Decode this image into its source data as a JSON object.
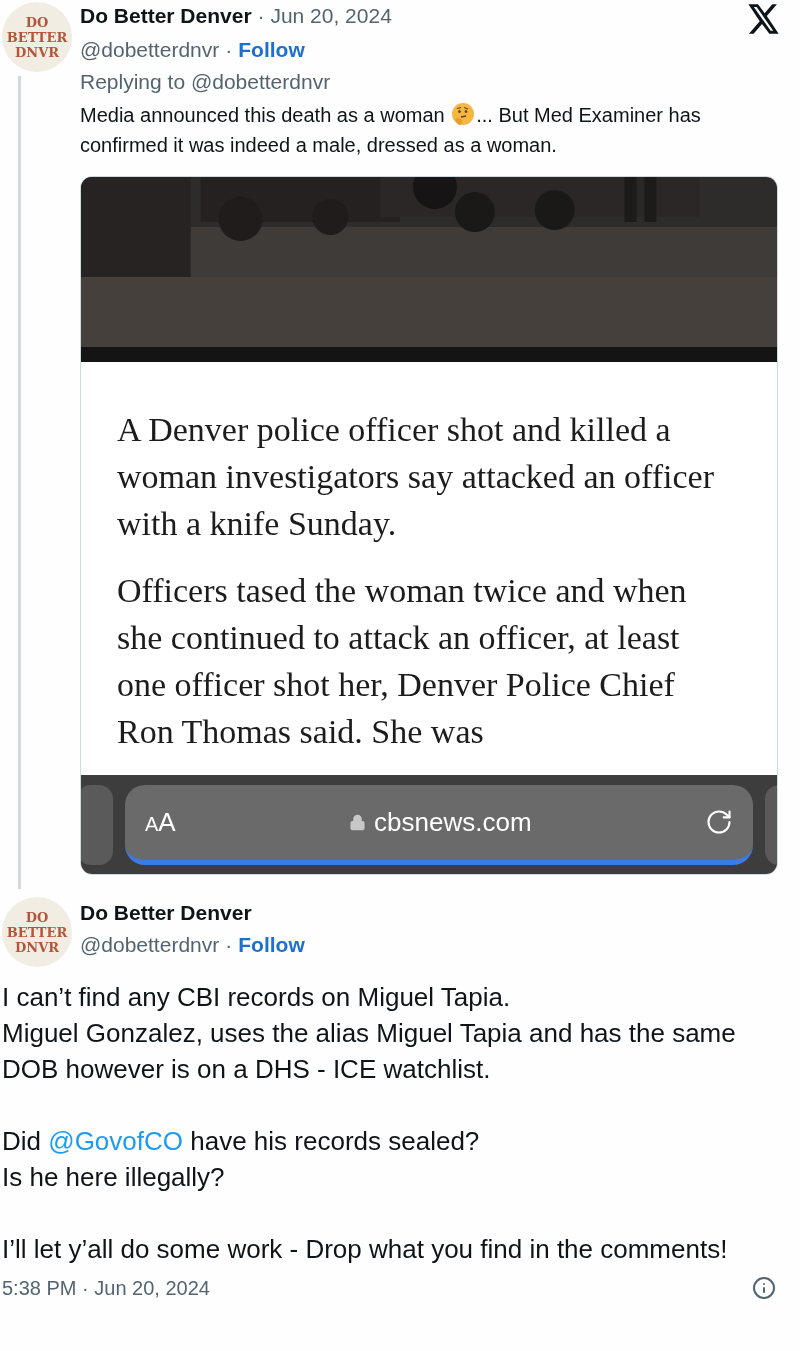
{
  "reply_tweet": {
    "avatar_lines": [
      "DO",
      "BETTER",
      "DNVR"
    ],
    "name": "Do Better Denver",
    "date": "· Jun 20, 2024",
    "handle": "@dobetterdnvr",
    "separator": "·",
    "follow": "Follow",
    "replying_to": "Replying to @dobetterdnvr",
    "text_parts": [
      {
        "kind": "text",
        "text": "Media announced this death as a woman "
      },
      {
        "kind": "emoji"
      },
      {
        "kind": "text",
        "text": "... But Med Examiner has confirmed it was indeed a male, dressed as a woman."
      }
    ],
    "attachment": {
      "video": {
        "kind": "picture"
      },
      "article_paragraphs": [
        "A Denver police officer shot and killed a woman investigators say attacked an officer with a knife Sunday.",
        "Officers tased the woman twice and when she continued to attack an officer, at least one officer shot her, Denver Police Chief Ron Thomas said. She was"
      ],
      "browser_bar": {
        "text_size": "AA",
        "url": "cbsnews.com"
      }
    }
  },
  "main_tweet": {
    "avatar_lines": [
      "DO",
      "BETTER",
      "DNVR"
    ],
    "name": "Do Better Denver",
    "handle": "@dobetterdnvr",
    "separator": "·",
    "follow": "Follow",
    "paragraphs": [
      [
        [
          {
            "kind": "text",
            "text": "I can’t find any CBI records on Miguel Tapia."
          }
        ],
        [
          {
            "kind": "text",
            "text": "Miguel Gonzalez, uses the alias Miguel Tapia and has the same DOB however is on a DHS - ICE watchlist."
          }
        ]
      ],
      [
        [
          {
            "kind": "text",
            "text": "Did "
          },
          {
            "kind": "mention",
            "text": "@GovofCO"
          },
          {
            "kind": "text",
            "text": " have his records sealed?"
          }
        ],
        [
          {
            "kind": "text",
            "text": "Is he here illegally?"
          }
        ]
      ],
      [
        [
          {
            "kind": "text",
            "text": "I’ll let y’all do some work - Drop what you find in the comments!"
          }
        ]
      ]
    ],
    "timestamp": "5:38 PM · Jun 20, 2024"
  }
}
